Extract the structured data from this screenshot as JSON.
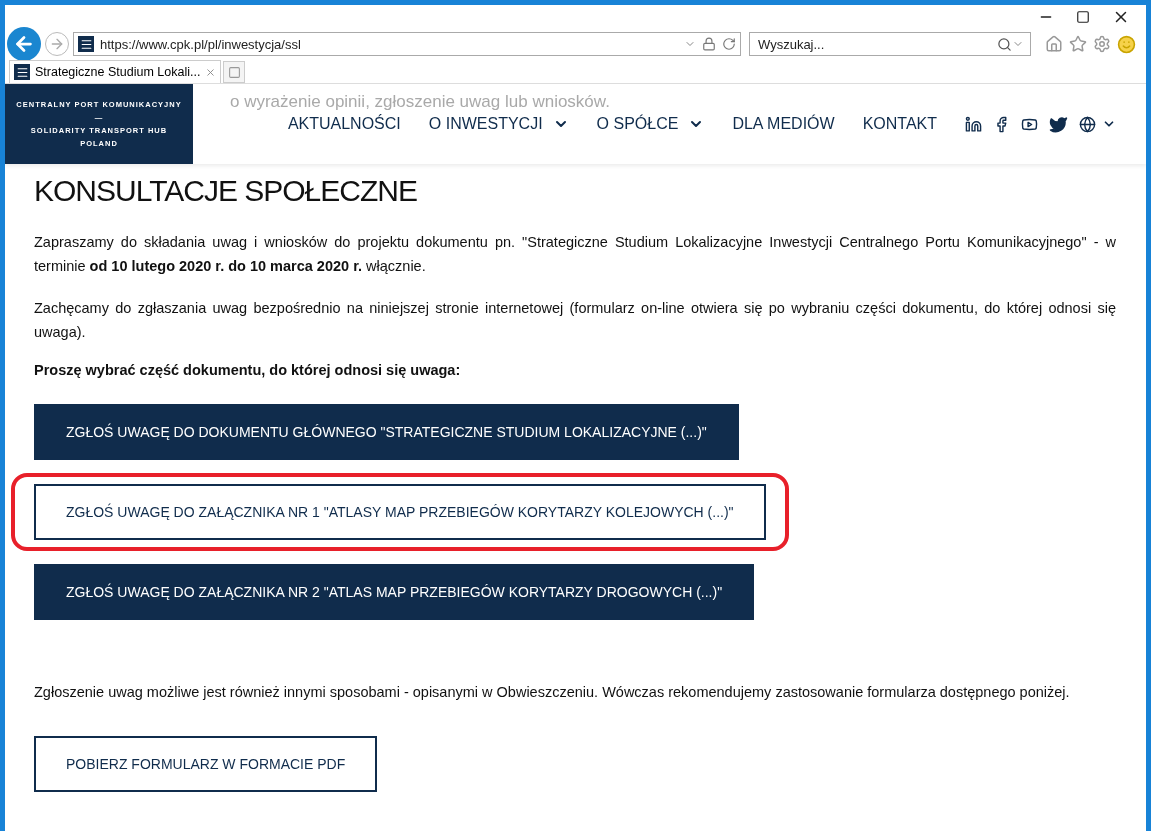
{
  "browser": {
    "address": "https://www.cpk.pl/pl/inwestycja/ssl",
    "search": {
      "placeholder": "Wyszukaj..."
    },
    "tabs": [
      {
        "label": "Strategiczne Studium Lokali...",
        "selected": true
      }
    ]
  },
  "header": {
    "ghost_text": "o wyrażenie opinii, zgłoszenie uwag lub wniosków.",
    "logo": {
      "line1": "CENTRALNY PORT KOMUNIKACYJNY",
      "dash": "—",
      "line2": "SOLIDARITY TRANSPORT HUB",
      "line3": "POLAND"
    },
    "nav": [
      {
        "label": "AKTUALNOŚCI",
        "dropdown": false
      },
      {
        "label": "O INWESTYCJI",
        "dropdown": true
      },
      {
        "label": "O SPÓŁCE",
        "dropdown": true
      },
      {
        "label": "DLA MEDIÓW",
        "dropdown": false
      },
      {
        "label": "KONTAKT",
        "dropdown": false
      }
    ]
  },
  "content": {
    "title": "KONSULTACJE SPOŁECZNE",
    "paragraphs": [
      "Zapraszamy do składania uwag i wniosków do projektu dokumentu pn. \"Strategiczne Studium Lokalizacyjne Inwestycji Centralnego Portu Komunikacyjnego\" - w terminie **od 10 lutego 2020 r. do 10 marca 2020 r.** włącznie.",
      "Zachęcamy do zgłaszania uwag bezpośrednio na niniejszej stronie internetowej (formularz on-line otwiera się po wybraniu części dokumentu, do której odnosi się uwaga)."
    ],
    "prompt": "Proszę wybrać część dokumentu, do której odnosi się uwaga:",
    "buttons": [
      {
        "label": "ZGŁOŚ UWAGĘ DO DOKUMENTU GŁÓWNEGO \"STRATEGICZNE STUDIUM LOKALIZACYJNE (...)\"",
        "kind": "filled",
        "highlighted": false
      },
      {
        "label": "ZGŁOŚ UWAGĘ DO ZAŁĄCZNIKA NR 1 \"ATLASY MAP PRZEBIEGÓW KORYTARZY KOLEJOWYCH (...)\"",
        "kind": "outline",
        "highlighted": true
      },
      {
        "label": "ZGŁOŚ UWAGĘ DO ZAŁĄCZNIKA NR 2 \"ATLAS MAP PRZEBIEGÓW KORYTARZY DROGOWYCH (...)\"",
        "kind": "filled",
        "highlighted": false
      }
    ],
    "note": "Zgłoszenie uwag możliwe jest również innymi sposobami - opisanymi w Obwieszczeniu. Wówczas rekomendujemy zastosowanie formularza dostępnego poniżej.",
    "download": {
      "label": "POBIERZ FORMULARZ W FORMACIE PDF",
      "kind": "outline"
    }
  }
}
